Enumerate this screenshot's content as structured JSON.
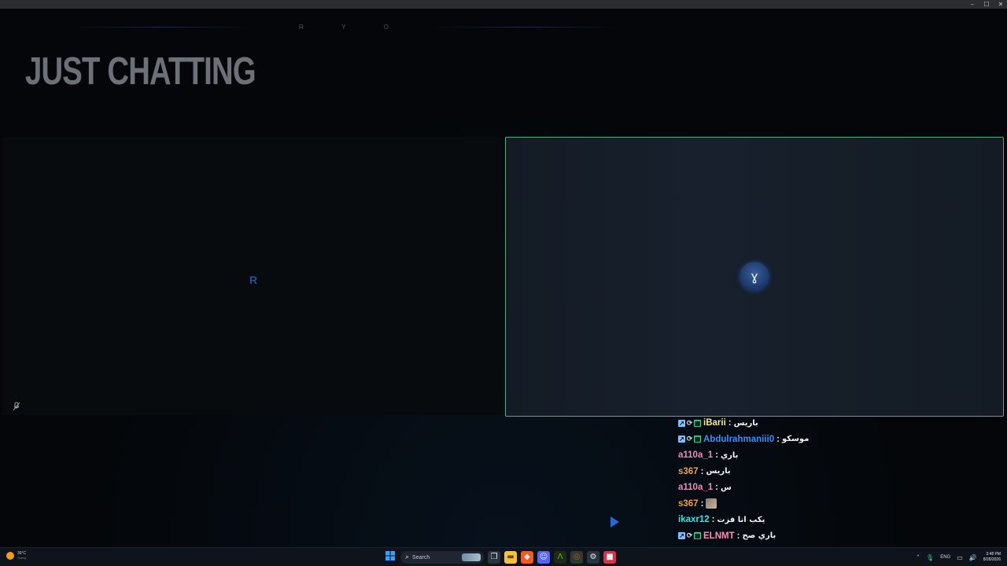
{
  "window": {
    "controls": [
      "–",
      "☐",
      "✕"
    ]
  },
  "overlay": {
    "letters": [
      "R",
      "Y",
      "O"
    ],
    "category_title": "JUST CHATTING",
    "logo_left": "R",
    "spinner_glyph": "ɣ",
    "muted_glyph": "🎤"
  },
  "chat": [
    {
      "user": "iBarii",
      "user_color": "#f2e79b",
      "message": "باريس",
      "badges": true,
      "emote": false
    },
    {
      "user": "Abdulrahmaniii0",
      "user_color": "#3c8cff",
      "message": "موسكو",
      "badges": true,
      "emote": false
    },
    {
      "user": "a110a_1",
      "user_color": "#f28ab8",
      "message": "باري",
      "badges": false,
      "emote": false
    },
    {
      "user": "s367",
      "user_color": "#f0a04b",
      "message": "باريس",
      "badges": false,
      "emote": false
    },
    {
      "user": "a110a_1",
      "user_color": "#f28ab8",
      "message": "س",
      "badges": false,
      "emote": false
    },
    {
      "user": "s367",
      "user_color": "#f0a04b",
      "message": "",
      "badges": false,
      "emote": true
    },
    {
      "user": "ikaxr12",
      "user_color": "#3fe3e3",
      "message": "يكب انا فزت",
      "badges": false,
      "emote": false
    },
    {
      "user": "ELNMT",
      "user_color": "#ff8db0",
      "message": "باري صح",
      "badges": true,
      "emote": false
    }
  ],
  "taskbar": {
    "weather": {
      "temp": "36°C",
      "condition": "Sunny"
    },
    "search_placeholder": "Search",
    "language": "ENG",
    "time": "3:48 PM",
    "date": "8/28/2026"
  }
}
